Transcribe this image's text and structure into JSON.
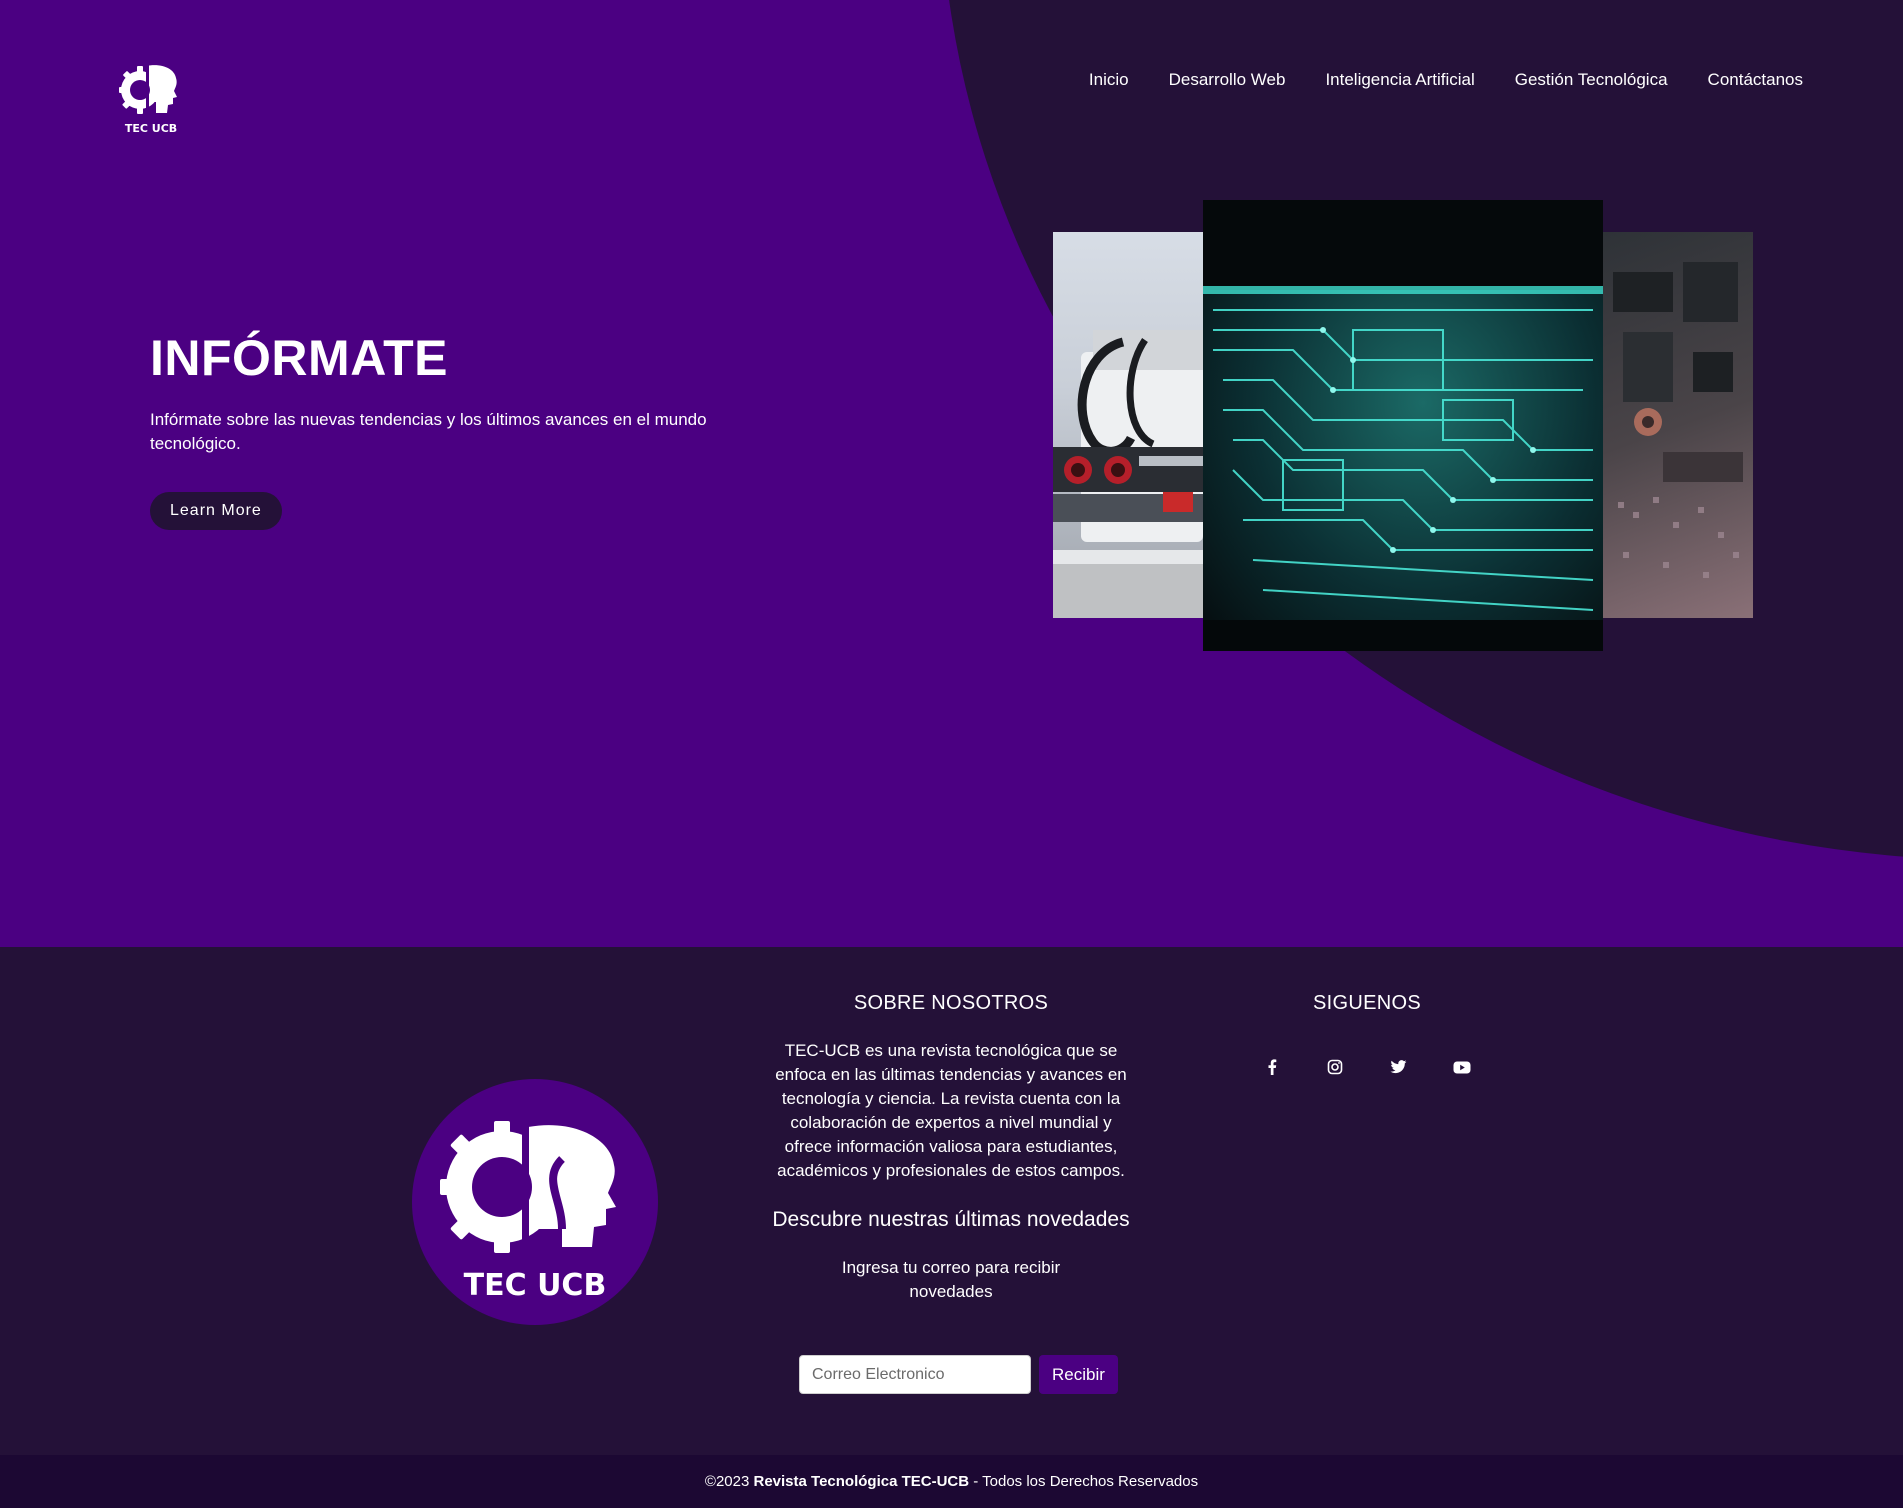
{
  "brand": {
    "logo_text": "TEC UCB"
  },
  "nav": {
    "items": [
      "Inicio",
      "Desarrollo Web",
      "Inteligencia Artificial",
      "Gestión Tecnológica",
      "Contáctanos"
    ]
  },
  "hero": {
    "title": "INFÓRMATE",
    "description": "Infórmate sobre las nuevas tendencias y los últimos avances en el mundo tecnológico.",
    "button_label": "Learn More"
  },
  "gallery": {
    "images": [
      "robot-photo",
      "circuit-board-photo",
      "motherboard-photo"
    ]
  },
  "footer": {
    "about": {
      "title": "SOBRE NOSOTROS",
      "text": "TEC-UCB es una revista tecnológica que se enfoca en las últimas tendencias y avances en tecnología y ciencia. La revista cuenta con la colaboración de expertos a nivel mundial y ofrece información valiosa para estudiantes, académicos y profesionales de estos campos."
    },
    "newsletter": {
      "title": "Descubre nuestras últimas novedades",
      "text": "Ingresa tu correo para recibir novedades",
      "placeholder": "Correo Electronico",
      "button_label": "Recibir"
    },
    "social": {
      "title": "SIGUENOS",
      "icons": [
        "facebook-icon",
        "instagram-icon",
        "twitter-icon",
        "youtube-icon"
      ]
    },
    "copyright": {
      "prefix": "©2023 ",
      "brand": "Revista Tecnológica TEC-UCB",
      "suffix": " - Todos los Derechos Reservados"
    }
  },
  "colors": {
    "primary": "#4b0082",
    "dark": "#241138",
    "bottom_bar": "#1c0833"
  }
}
